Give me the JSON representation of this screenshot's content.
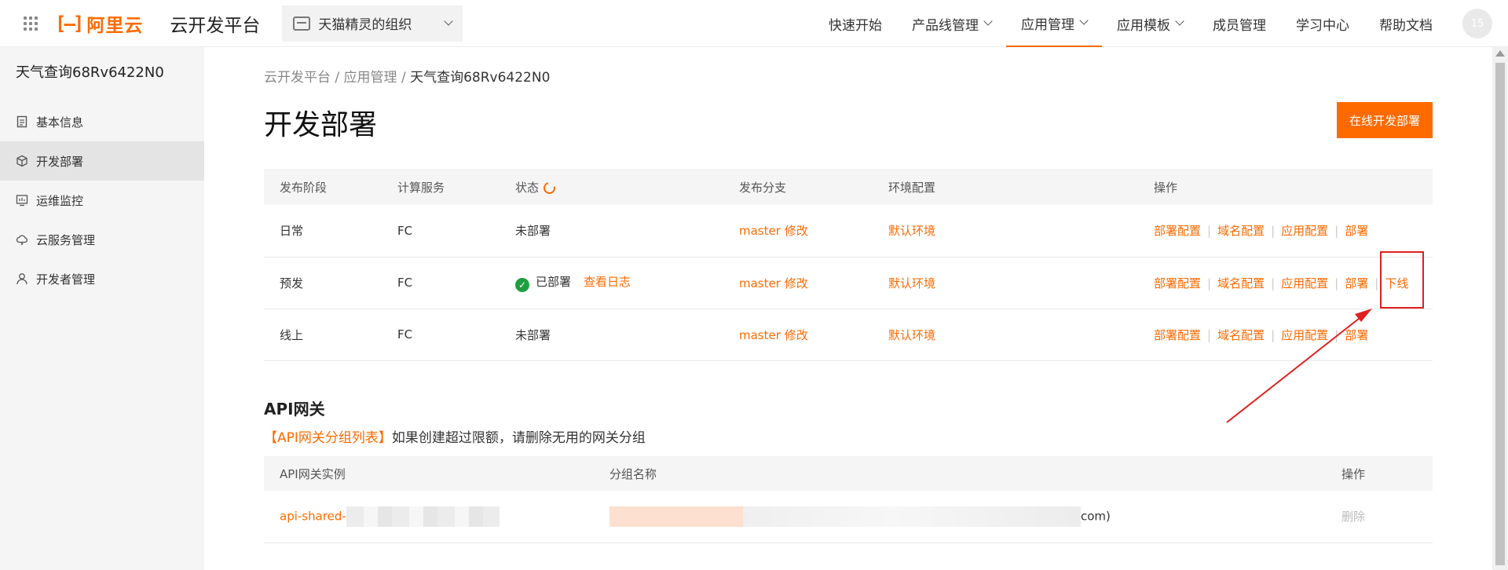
{
  "header": {
    "brand": "阿里云",
    "product": "云开发平台",
    "org": "天猫精灵的组织",
    "nav": [
      {
        "label": "快速开始",
        "dropdown": false
      },
      {
        "label": "产品线管理",
        "dropdown": true
      },
      {
        "label": "应用管理",
        "dropdown": true,
        "active": true
      },
      {
        "label": "应用模板",
        "dropdown": true
      },
      {
        "label": "成员管理",
        "dropdown": false
      },
      {
        "label": "学习中心",
        "dropdown": false
      },
      {
        "label": "帮助文档",
        "dropdown": false
      }
    ],
    "avatar": "15"
  },
  "sidebar": {
    "app_name": "天气查询68Rv6422N0",
    "items": [
      {
        "label": "基本信息",
        "icon": "document-icon"
      },
      {
        "label": "开发部署",
        "icon": "cube-icon",
        "active": true
      },
      {
        "label": "运维监控",
        "icon": "monitor-icon"
      },
      {
        "label": "云服务管理",
        "icon": "cloud-icon"
      },
      {
        "label": "开发者管理",
        "icon": "user-icon"
      }
    ]
  },
  "breadcrumb": {
    "root": "云开发平台",
    "mid": "应用管理",
    "current": "天气查询68Rv6422N0",
    "sep": "/"
  },
  "page": {
    "title": "开发部署",
    "primary_action": "在线开发部署"
  },
  "deploy_table": {
    "headers": [
      "发布阶段",
      "计算服务",
      "状态",
      "发布分支",
      "环境配置",
      "操作"
    ],
    "rows": [
      {
        "stage": "日常",
        "service": "FC",
        "status": "未部署",
        "deployed": false,
        "branch": "master",
        "branch_edit": "修改",
        "env": "默认环境",
        "ops": [
          "部署配置",
          "域名配置",
          "应用配置",
          "部署"
        ]
      },
      {
        "stage": "预发",
        "service": "FC",
        "status": "已部署",
        "deployed": true,
        "log": "查看日志",
        "branch": "master",
        "branch_edit": "修改",
        "env": "默认环境",
        "ops": [
          "部署配置",
          "域名配置",
          "应用配置",
          "部署",
          "下线"
        ]
      },
      {
        "stage": "线上",
        "service": "FC",
        "status": "未部署",
        "deployed": false,
        "branch": "master",
        "branch_edit": "修改",
        "env": "默认环境",
        "ops": [
          "部署配置",
          "域名配置",
          "应用配置",
          "部署"
        ]
      }
    ]
  },
  "api": {
    "title": "API网关",
    "notice_link": "【API网关分组列表】",
    "notice_text": "如果创建超过限额，请删除无用的网关分组",
    "headers": [
      "API网关实例",
      "分组名称",
      "操作"
    ],
    "rows": [
      {
        "instance": "api-shared-",
        "group_suffix": "com)",
        "action": "删除"
      }
    ]
  },
  "colors": {
    "accent": "#ff6a00",
    "success": "#1f9e3f",
    "annotation": "#e02020"
  }
}
